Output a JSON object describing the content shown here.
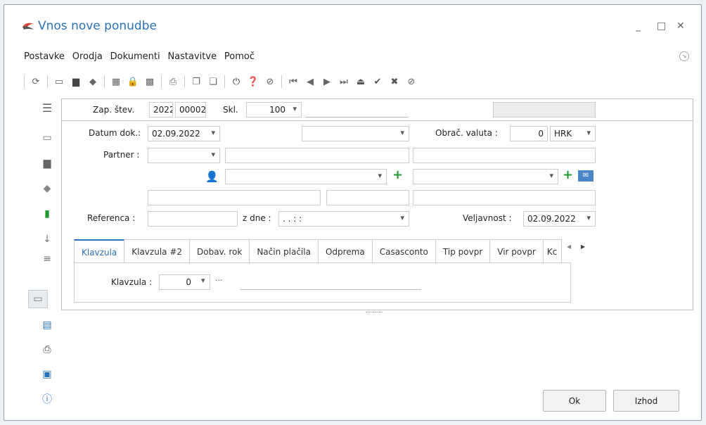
{
  "window": {
    "title": "Vnos nove ponudbe"
  },
  "menu": [
    "Postavke",
    "Orodja",
    "Dokumenti",
    "Nastavitve",
    "Pomoč"
  ],
  "header": {
    "zap_label": "Zap. štev.",
    "year": "2022",
    "number": "00002",
    "skl_label": "Skl.",
    "skl_value": "100"
  },
  "form": {
    "datum_label": "Datum dok.:",
    "datum_value": "02.09.2022",
    "obrac_label": "Obrač. valuta :",
    "valuta_amount": "0",
    "valuta_code": "HRK",
    "partner_label": "Partner :",
    "referenca_label": "Referenca :",
    "zdne_label": "z dne :",
    "zdne_value": ". .  : :",
    "veljavnost_label": "Veljavnost :",
    "veljavnost_value": "02.09.2022"
  },
  "tabs": [
    "Klavzula",
    "Klavzula #2",
    "Dobav. rok",
    "Način plačila",
    "Odprema",
    "Casasconto",
    "Tip povpr",
    "Vir povpr",
    "Kc"
  ],
  "klavzula": {
    "label": "Klavzula :",
    "value": "0",
    "more": "···"
  },
  "buttons": {
    "ok": "Ok",
    "exit": "Izhod"
  },
  "icons": {
    "sidebar": [
      "hamburger-icon",
      "new-doc-icon",
      "folder-icon",
      "eraser-icon",
      "green-doc-icon",
      "arrow-down-icon",
      "list-icon",
      "add-doc-icon",
      "search-table-icon",
      "print-icon",
      "columns-icon",
      "info-icon"
    ]
  }
}
